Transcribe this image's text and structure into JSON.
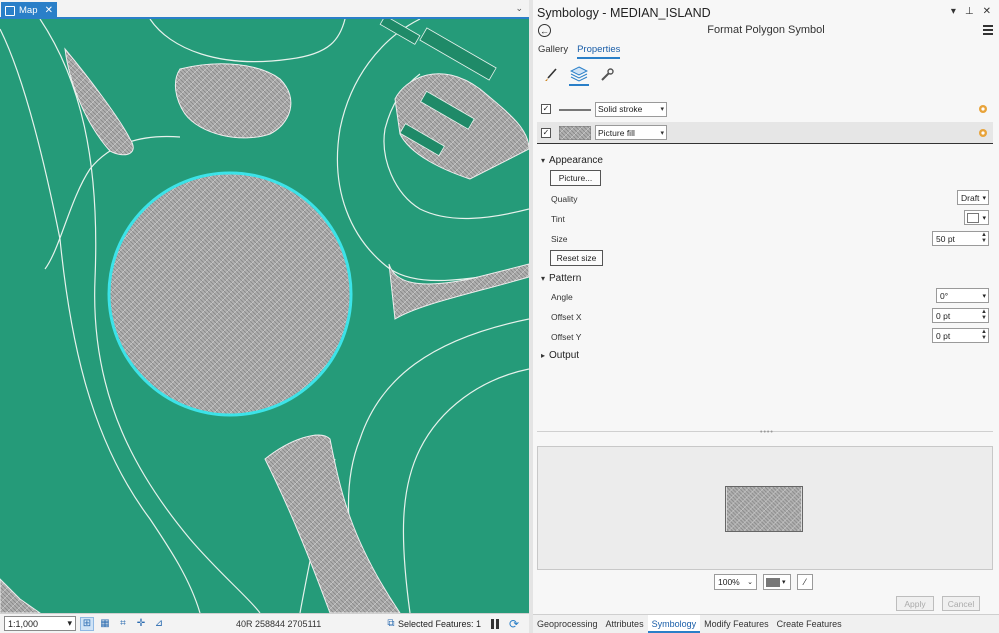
{
  "map": {
    "tab_label": "Map",
    "scale": "1:1,000",
    "coordinates": "40R 258844 2705111",
    "selected_features": "Selected Features: 1"
  },
  "pane": {
    "title": "Symbology - MEDIAN_ISLAND",
    "subtitle": "Format Polygon Symbol",
    "tabs": [
      "Gallery",
      "Properties"
    ],
    "active_tab": "Properties",
    "layers": [
      {
        "label": "Solid stroke",
        "checked": true
      },
      {
        "label": "Picture fill",
        "checked": true
      }
    ],
    "appearance": {
      "header": "Appearance",
      "picture_button": "Picture...",
      "quality_label": "Quality",
      "quality_value": "Draft",
      "tint_label": "Tint",
      "size_label": "Size",
      "size_value": "50 pt",
      "reset_button": "Reset size"
    },
    "pattern": {
      "header": "Pattern",
      "angle_label": "Angle",
      "angle_value": "0°",
      "offset_x_label": "Offset X",
      "offset_x_value": "0 pt",
      "offset_y_label": "Offset Y",
      "offset_y_value": "0 pt"
    },
    "output": {
      "header": "Output"
    },
    "preview": {
      "zoom": "100%"
    },
    "apply_label": "Apply",
    "cancel_label": "Cancel",
    "bottom_tabs": [
      "Geoprocessing",
      "Attributes",
      "Symbology",
      "Modify Features",
      "Create Features"
    ],
    "active_bottom_tab": "Symbology"
  },
  "colors": {
    "map_bg": "#259b79",
    "island_fill": "#a9a9a9",
    "selection": "#3ce3e8",
    "accent": "#2a7fc8"
  }
}
